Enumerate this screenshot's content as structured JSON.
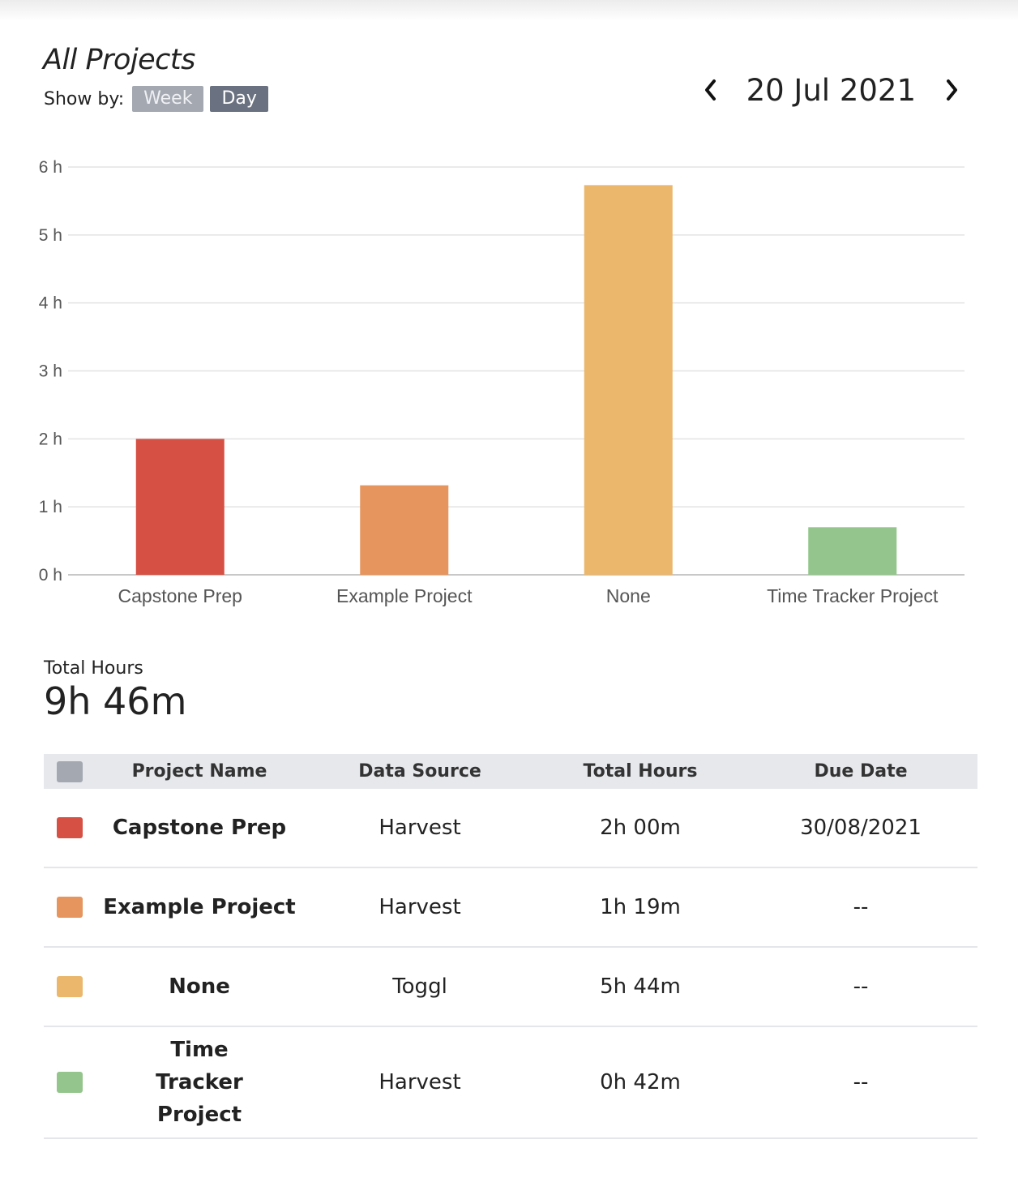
{
  "header": {
    "title": "All Projects",
    "show_by_label": "Show by:",
    "week_label": "Week",
    "day_label": "Day",
    "date": "20 Jul 2021",
    "prev_icon": "chevron-left-icon",
    "next_icon": "chevron-right-icon"
  },
  "chart_data": {
    "type": "bar",
    "categories": [
      "Capstone Prep",
      "Example Project",
      "None",
      "Time Tracker Project"
    ],
    "values": [
      2.0,
      1.3167,
      5.7333,
      0.7
    ],
    "colors": [
      "#d65044",
      "#e6955e",
      "#ebb76d",
      "#94c58c"
    ],
    "y_ticks": [
      "0 h",
      "1 h",
      "2 h",
      "3 h",
      "4 h",
      "5 h",
      "6 h"
    ],
    "ylim": [
      0,
      6
    ],
    "grid": true
  },
  "summary": {
    "total_label": "Total Hours",
    "total_value": "9h 46m"
  },
  "table": {
    "headers": [
      "Project Name",
      "Data Source",
      "Total Hours",
      "Due Date"
    ],
    "header_swatch_color": "#a3a8b1",
    "rows": [
      {
        "name": "Capstone Prep",
        "source": "Harvest",
        "hours": "2h 00m",
        "due": "30/08/2021",
        "color": "#d65044"
      },
      {
        "name": "Example Project",
        "source": "Harvest",
        "hours": "1h 19m",
        "due": "--",
        "color": "#e6955e"
      },
      {
        "name": "None",
        "source": "Toggl",
        "hours": "5h 44m",
        "due": "--",
        "color": "#ebb76d"
      },
      {
        "name": "Time Tracker Project",
        "source": "Harvest",
        "hours": "0h 42m",
        "due": "--",
        "color": "#94c58c"
      }
    ]
  }
}
